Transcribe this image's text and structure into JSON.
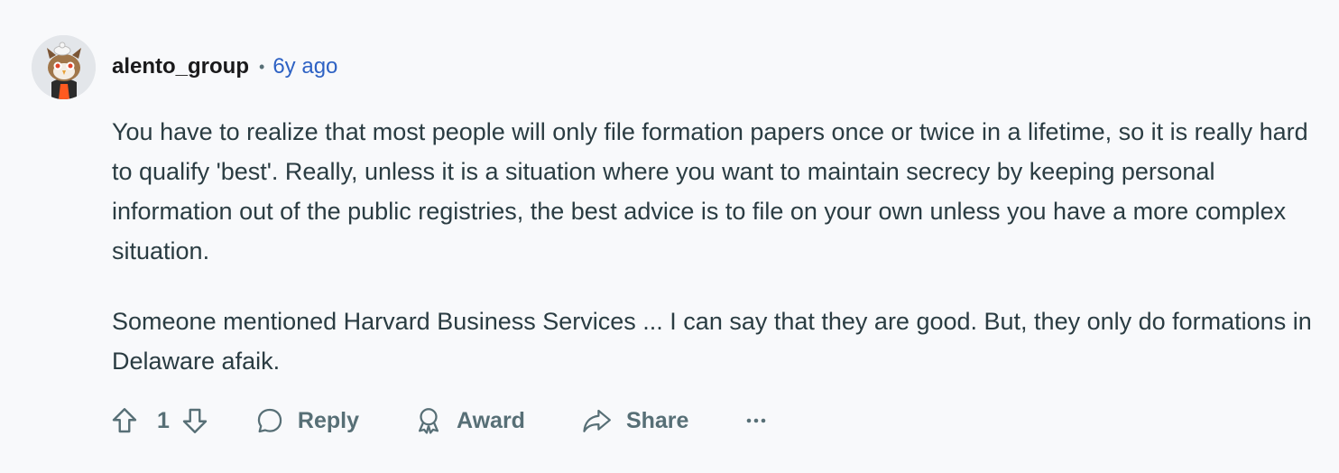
{
  "comment": {
    "username": "alento_group",
    "separator": "•",
    "timestamp": "6y ago",
    "paragraphs": [
      "You have to realize that most people will only file formation papers once or twice in a lifetime, so it is really hard to qualify 'best'. Really, unless it is a situation where you want to maintain secrecy by keeping personal information out of the public registries, the best advice is to file on your own unless you have a more complex situation.",
      "Someone mentioned Harvard Business Services ... I can say that they are good. But, they only do formations in Delaware afaik."
    ],
    "avatar_icon": "snoo-owl-avatar"
  },
  "actions": {
    "upvote_icon": "arrow-up-outline-icon",
    "score": "1",
    "downvote_icon": "arrow-down-outline-icon",
    "reply_label": "Reply",
    "reply_icon": "speech-bubble-icon",
    "award_label": "Award",
    "award_icon": "award-ribbon-icon",
    "share_label": "Share",
    "share_icon": "share-arrow-icon",
    "more_icon": "ellipsis-icon"
  },
  "colors": {
    "background": "#f8f9fb",
    "text": "#2a3c42",
    "meta_gray": "#576f76",
    "timestamp_blue": "#2e62c4"
  }
}
